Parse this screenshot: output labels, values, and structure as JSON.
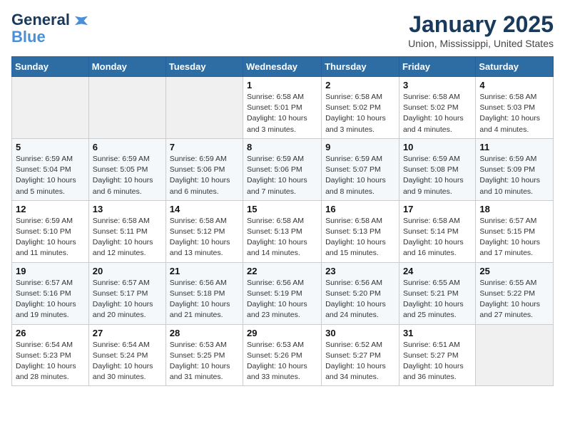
{
  "header": {
    "logo_line1": "General",
    "logo_line2": "Blue",
    "title": "January 2025",
    "subtitle": "Union, Mississippi, United States"
  },
  "calendar": {
    "days_of_week": [
      "Sunday",
      "Monday",
      "Tuesday",
      "Wednesday",
      "Thursday",
      "Friday",
      "Saturday"
    ],
    "weeks": [
      [
        {
          "day": "",
          "info": ""
        },
        {
          "day": "",
          "info": ""
        },
        {
          "day": "",
          "info": ""
        },
        {
          "day": "1",
          "info": "Sunrise: 6:58 AM\nSunset: 5:01 PM\nDaylight: 10 hours\nand 3 minutes."
        },
        {
          "day": "2",
          "info": "Sunrise: 6:58 AM\nSunset: 5:02 PM\nDaylight: 10 hours\nand 3 minutes."
        },
        {
          "day": "3",
          "info": "Sunrise: 6:58 AM\nSunset: 5:02 PM\nDaylight: 10 hours\nand 4 minutes."
        },
        {
          "day": "4",
          "info": "Sunrise: 6:58 AM\nSunset: 5:03 PM\nDaylight: 10 hours\nand 4 minutes."
        }
      ],
      [
        {
          "day": "5",
          "info": "Sunrise: 6:59 AM\nSunset: 5:04 PM\nDaylight: 10 hours\nand 5 minutes."
        },
        {
          "day": "6",
          "info": "Sunrise: 6:59 AM\nSunset: 5:05 PM\nDaylight: 10 hours\nand 6 minutes."
        },
        {
          "day": "7",
          "info": "Sunrise: 6:59 AM\nSunset: 5:06 PM\nDaylight: 10 hours\nand 6 minutes."
        },
        {
          "day": "8",
          "info": "Sunrise: 6:59 AM\nSunset: 5:06 PM\nDaylight: 10 hours\nand 7 minutes."
        },
        {
          "day": "9",
          "info": "Sunrise: 6:59 AM\nSunset: 5:07 PM\nDaylight: 10 hours\nand 8 minutes."
        },
        {
          "day": "10",
          "info": "Sunrise: 6:59 AM\nSunset: 5:08 PM\nDaylight: 10 hours\nand 9 minutes."
        },
        {
          "day": "11",
          "info": "Sunrise: 6:59 AM\nSunset: 5:09 PM\nDaylight: 10 hours\nand 10 minutes."
        }
      ],
      [
        {
          "day": "12",
          "info": "Sunrise: 6:59 AM\nSunset: 5:10 PM\nDaylight: 10 hours\nand 11 minutes."
        },
        {
          "day": "13",
          "info": "Sunrise: 6:58 AM\nSunset: 5:11 PM\nDaylight: 10 hours\nand 12 minutes."
        },
        {
          "day": "14",
          "info": "Sunrise: 6:58 AM\nSunset: 5:12 PM\nDaylight: 10 hours\nand 13 minutes."
        },
        {
          "day": "15",
          "info": "Sunrise: 6:58 AM\nSunset: 5:13 PM\nDaylight: 10 hours\nand 14 minutes."
        },
        {
          "day": "16",
          "info": "Sunrise: 6:58 AM\nSunset: 5:13 PM\nDaylight: 10 hours\nand 15 minutes."
        },
        {
          "day": "17",
          "info": "Sunrise: 6:58 AM\nSunset: 5:14 PM\nDaylight: 10 hours\nand 16 minutes."
        },
        {
          "day": "18",
          "info": "Sunrise: 6:57 AM\nSunset: 5:15 PM\nDaylight: 10 hours\nand 17 minutes."
        }
      ],
      [
        {
          "day": "19",
          "info": "Sunrise: 6:57 AM\nSunset: 5:16 PM\nDaylight: 10 hours\nand 19 minutes."
        },
        {
          "day": "20",
          "info": "Sunrise: 6:57 AM\nSunset: 5:17 PM\nDaylight: 10 hours\nand 20 minutes."
        },
        {
          "day": "21",
          "info": "Sunrise: 6:56 AM\nSunset: 5:18 PM\nDaylight: 10 hours\nand 21 minutes."
        },
        {
          "day": "22",
          "info": "Sunrise: 6:56 AM\nSunset: 5:19 PM\nDaylight: 10 hours\nand 23 minutes."
        },
        {
          "day": "23",
          "info": "Sunrise: 6:56 AM\nSunset: 5:20 PM\nDaylight: 10 hours\nand 24 minutes."
        },
        {
          "day": "24",
          "info": "Sunrise: 6:55 AM\nSunset: 5:21 PM\nDaylight: 10 hours\nand 25 minutes."
        },
        {
          "day": "25",
          "info": "Sunrise: 6:55 AM\nSunset: 5:22 PM\nDaylight: 10 hours\nand 27 minutes."
        }
      ],
      [
        {
          "day": "26",
          "info": "Sunrise: 6:54 AM\nSunset: 5:23 PM\nDaylight: 10 hours\nand 28 minutes."
        },
        {
          "day": "27",
          "info": "Sunrise: 6:54 AM\nSunset: 5:24 PM\nDaylight: 10 hours\nand 30 minutes."
        },
        {
          "day": "28",
          "info": "Sunrise: 6:53 AM\nSunset: 5:25 PM\nDaylight: 10 hours\nand 31 minutes."
        },
        {
          "day": "29",
          "info": "Sunrise: 6:53 AM\nSunset: 5:26 PM\nDaylight: 10 hours\nand 33 minutes."
        },
        {
          "day": "30",
          "info": "Sunrise: 6:52 AM\nSunset: 5:27 PM\nDaylight: 10 hours\nand 34 minutes."
        },
        {
          "day": "31",
          "info": "Sunrise: 6:51 AM\nSunset: 5:27 PM\nDaylight: 10 hours\nand 36 minutes."
        },
        {
          "day": "",
          "info": ""
        }
      ]
    ]
  }
}
